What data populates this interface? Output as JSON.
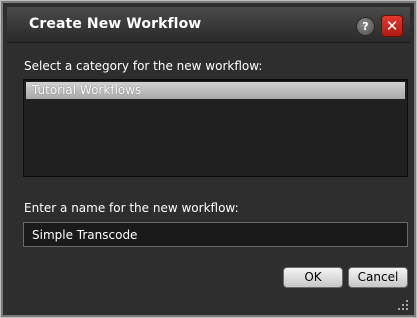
{
  "window": {
    "title": "Create New Workflow",
    "help_glyph": "?",
    "close_glyph": "✕"
  },
  "category": {
    "label": "Select a category for the new workflow:",
    "items": [
      "Tutorial Workflows"
    ],
    "selected": "Tutorial Workflows"
  },
  "name": {
    "label": "Enter a name for the new workflow:",
    "value": "Simple Transcode"
  },
  "buttons": {
    "ok": "OK",
    "cancel": "Cancel"
  },
  "icons": {
    "help": "help-icon",
    "close": "close-icon",
    "resize": "resize-grip-icon"
  },
  "colors": {
    "dialog_bg": "#2e2e2e",
    "close_red": "#d0261b",
    "selection": "#b8b8b8"
  }
}
